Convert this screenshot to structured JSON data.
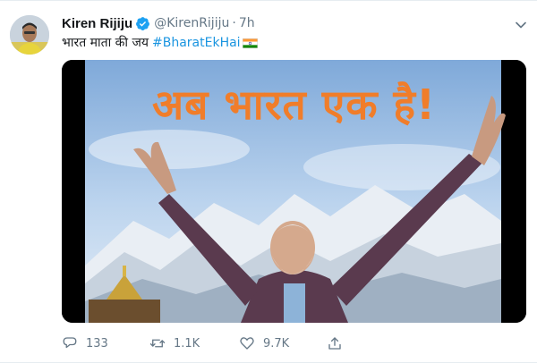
{
  "tweet": {
    "author_name": "Kiren Rijiju",
    "handle": "@KirenRijiju",
    "separator": "·",
    "time": "7h",
    "text": "भारत माता की जय",
    "hashtag": "#BharatEkHai",
    "flag_icon": "india-flag-icon",
    "image_headline": "अब भारत एक है!"
  },
  "actions": {
    "reply_count": "133",
    "retweet_count": "1.1K",
    "like_count": "9.7K"
  },
  "colors": {
    "link": "#1b95e0",
    "muted": "#657786",
    "verified": "#1da1f2",
    "headline": "#f07d2a"
  },
  "icons": [
    "verified-badge-icon",
    "chevron-down-icon",
    "reply-icon",
    "retweet-icon",
    "like-icon",
    "share-icon"
  ]
}
